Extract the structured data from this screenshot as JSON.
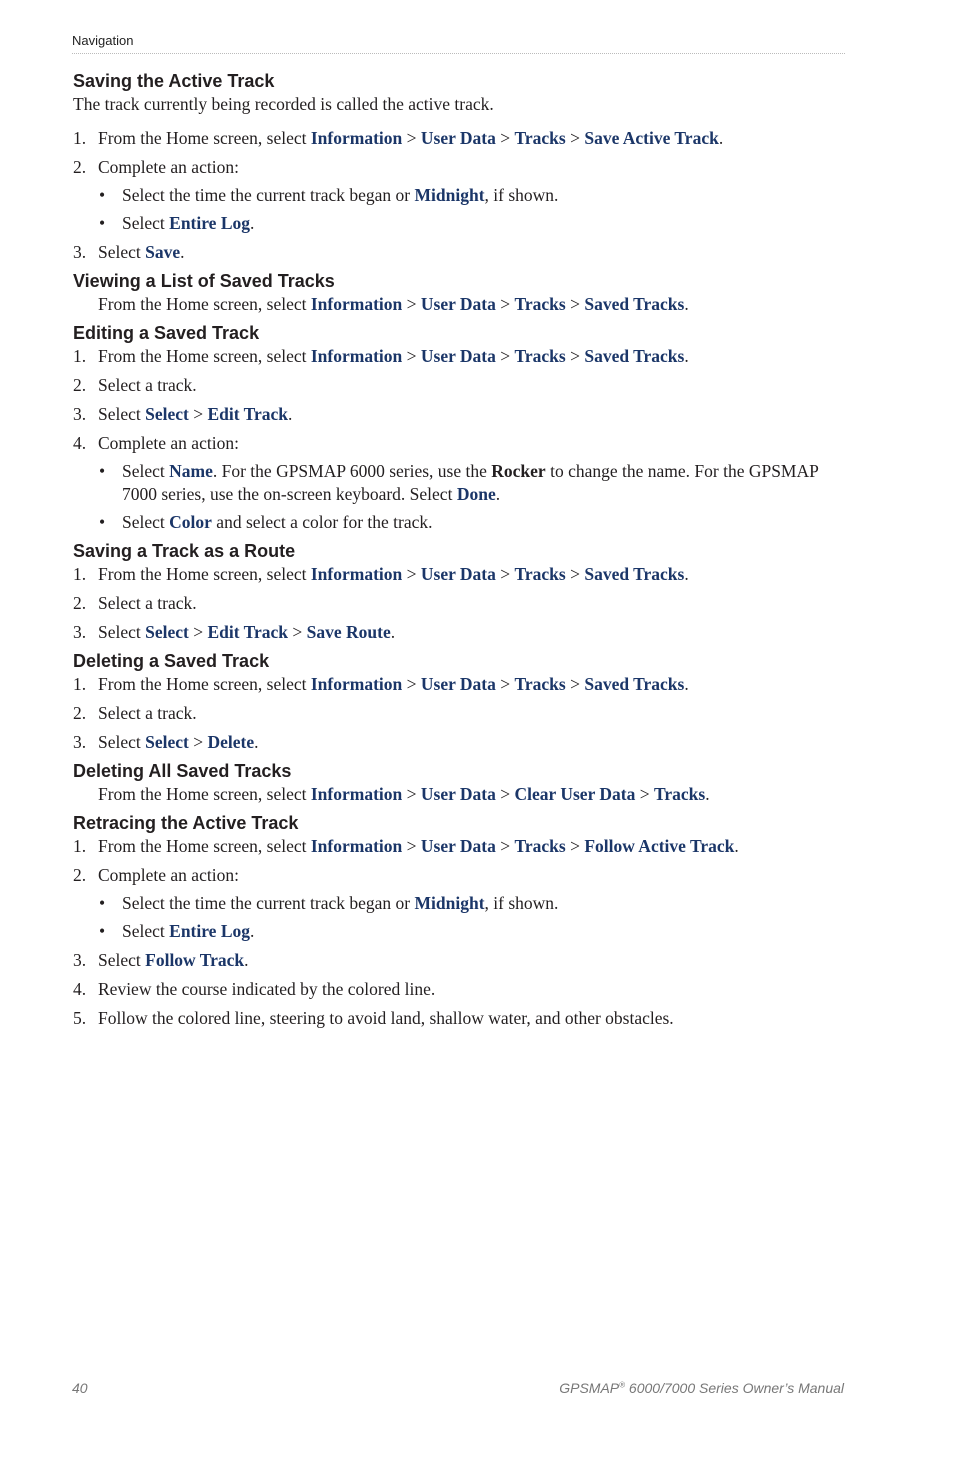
{
  "header": {
    "section": "Navigation"
  },
  "sections": [
    {
      "title": "Saving the Active Track",
      "blocks": [
        {
          "type": "para",
          "segs": [
            {
              "t": "The track currently being recorded is called the active track."
            }
          ]
        },
        {
          "type": "step",
          "num": "1.",
          "segs": [
            {
              "t": "From the Home screen, select "
            },
            {
              "t": "Information",
              "s": "k"
            },
            {
              "t": " > "
            },
            {
              "t": "User Data",
              "s": "k"
            },
            {
              "t": " > "
            },
            {
              "t": "Tracks",
              "s": "k"
            },
            {
              "t": " > "
            },
            {
              "t": "Save Active Track",
              "s": "k"
            },
            {
              "t": "."
            }
          ]
        },
        {
          "type": "step",
          "num": "2.",
          "segs": [
            {
              "t": "Complete an action:"
            }
          ]
        },
        {
          "type": "bullet",
          "segs": [
            {
              "t": "Select the time the current track began or "
            },
            {
              "t": "Midnight",
              "s": "k"
            },
            {
              "t": ", if shown."
            }
          ]
        },
        {
          "type": "bullet",
          "segs": [
            {
              "t": "Select "
            },
            {
              "t": "Entire Log",
              "s": "k"
            },
            {
              "t": "."
            }
          ]
        },
        {
          "type": "step",
          "num": "3.",
          "segs": [
            {
              "t": "Select "
            },
            {
              "t": "Save",
              "s": "k"
            },
            {
              "t": "."
            }
          ]
        }
      ]
    },
    {
      "title": "Viewing a List of Saved Tracks",
      "blocks": [
        {
          "type": "para-indent",
          "segs": [
            {
              "t": "From the Home screen, select "
            },
            {
              "t": "Information",
              "s": "k"
            },
            {
              "t": " > "
            },
            {
              "t": "User Data",
              "s": "k"
            },
            {
              "t": " > "
            },
            {
              "t": "Tracks",
              "s": "k"
            },
            {
              "t": " > "
            },
            {
              "t": "Saved Tracks",
              "s": "k"
            },
            {
              "t": "."
            }
          ]
        }
      ]
    },
    {
      "title": "Editing a Saved Track",
      "blocks": [
        {
          "type": "step",
          "num": "1.",
          "segs": [
            {
              "t": "From the Home screen, select "
            },
            {
              "t": "Information",
              "s": "k"
            },
            {
              "t": " > "
            },
            {
              "t": "User Data",
              "s": "k"
            },
            {
              "t": " > "
            },
            {
              "t": "Tracks",
              "s": "k"
            },
            {
              "t": " > "
            },
            {
              "t": "Saved Tracks",
              "s": "k"
            },
            {
              "t": "."
            }
          ]
        },
        {
          "type": "step",
          "num": "2.",
          "segs": [
            {
              "t": "Select a track."
            }
          ]
        },
        {
          "type": "step",
          "num": "3.",
          "segs": [
            {
              "t": "Select "
            },
            {
              "t": "Select",
              "s": "k"
            },
            {
              "t": " > "
            },
            {
              "t": "Edit Track",
              "s": "k"
            },
            {
              "t": "."
            }
          ]
        },
        {
          "type": "step",
          "num": "4.",
          "segs": [
            {
              "t": "Complete an action:"
            }
          ]
        },
        {
          "type": "bullet",
          "segs": [
            {
              "t": "Select "
            },
            {
              "t": "Name",
              "s": "k"
            },
            {
              "t": ". For the GPSMAP 6000 series, use the "
            },
            {
              "t": "Rocker",
              "s": "b"
            },
            {
              "t": " to change the name. For the GPSMAP 7000 series, use the on-screen keyboard. Select "
            },
            {
              "t": "Done",
              "s": "k"
            },
            {
              "t": "."
            }
          ]
        },
        {
          "type": "bullet",
          "segs": [
            {
              "t": "Select "
            },
            {
              "t": "Color",
              "s": "k"
            },
            {
              "t": " and select a color for the track."
            }
          ]
        }
      ]
    },
    {
      "title": "Saving a Track as a Route",
      "blocks": [
        {
          "type": "step",
          "num": "1.",
          "segs": [
            {
              "t": "From the Home screen, select "
            },
            {
              "t": "Information",
              "s": "k"
            },
            {
              "t": " > "
            },
            {
              "t": "User Data",
              "s": "k"
            },
            {
              "t": " > "
            },
            {
              "t": "Tracks",
              "s": "k"
            },
            {
              "t": " > "
            },
            {
              "t": "Saved Tracks",
              "s": "k"
            },
            {
              "t": "."
            }
          ]
        },
        {
          "type": "step",
          "num": "2.",
          "segs": [
            {
              "t": "Select a track."
            }
          ]
        },
        {
          "type": "step",
          "num": "3.",
          "segs": [
            {
              "t": "Select "
            },
            {
              "t": "Select",
              "s": "k"
            },
            {
              "t": " > "
            },
            {
              "t": "Edit Track",
              "s": "k"
            },
            {
              "t": " > "
            },
            {
              "t": "Save Route",
              "s": "k"
            },
            {
              "t": "."
            }
          ]
        }
      ]
    },
    {
      "title": "Deleting a Saved Track",
      "blocks": [
        {
          "type": "step",
          "num": "1.",
          "segs": [
            {
              "t": "From the Home screen, select "
            },
            {
              "t": "Information",
              "s": "k"
            },
            {
              "t": " > "
            },
            {
              "t": "User Data",
              "s": "k"
            },
            {
              "t": " > "
            },
            {
              "t": "Tracks",
              "s": "k"
            },
            {
              "t": " > "
            },
            {
              "t": "Saved Tracks",
              "s": "k"
            },
            {
              "t": "."
            }
          ]
        },
        {
          "type": "step",
          "num": "2.",
          "segs": [
            {
              "t": "Select a track."
            }
          ]
        },
        {
          "type": "step",
          "num": "3.",
          "segs": [
            {
              "t": "Select "
            },
            {
              "t": "Select",
              "s": "k"
            },
            {
              "t": " > "
            },
            {
              "t": "Delete",
              "s": "k"
            },
            {
              "t": "."
            }
          ]
        }
      ]
    },
    {
      "title": "Deleting All Saved Tracks",
      "blocks": [
        {
          "type": "para-indent",
          "segs": [
            {
              "t": "From the Home screen, select "
            },
            {
              "t": "Information",
              "s": "k"
            },
            {
              "t": " > "
            },
            {
              "t": "User Data",
              "s": "k"
            },
            {
              "t": " > "
            },
            {
              "t": "Clear User Data",
              "s": "k"
            },
            {
              "t": " > "
            },
            {
              "t": "Tracks",
              "s": "k"
            },
            {
              "t": "."
            }
          ]
        }
      ]
    },
    {
      "title": "Retracing the Active Track",
      "blocks": [
        {
          "type": "step",
          "num": "1.",
          "segs": [
            {
              "t": "From the Home screen, select "
            },
            {
              "t": "Information",
              "s": "k"
            },
            {
              "t": " > "
            },
            {
              "t": "User Data",
              "s": "k"
            },
            {
              "t": " > "
            },
            {
              "t": "Tracks",
              "s": "k"
            },
            {
              "t": " > "
            },
            {
              "t": "Follow Active Track",
              "s": "k"
            },
            {
              "t": "."
            }
          ]
        },
        {
          "type": "step",
          "num": "2.",
          "segs": [
            {
              "t": "Complete an action:"
            }
          ]
        },
        {
          "type": "bullet",
          "segs": [
            {
              "t": "Select the time the current track began or "
            },
            {
              "t": "Midnight",
              "s": "k"
            },
            {
              "t": ", if shown."
            }
          ]
        },
        {
          "type": "bullet",
          "segs": [
            {
              "t": "Select "
            },
            {
              "t": "Entire Log",
              "s": "k"
            },
            {
              "t": "."
            }
          ]
        },
        {
          "type": "step",
          "num": "3.",
          "segs": [
            {
              "t": "Select "
            },
            {
              "t": "Follow Track",
              "s": "k"
            },
            {
              "t": "."
            }
          ]
        },
        {
          "type": "step",
          "num": "4.",
          "segs": [
            {
              "t": "Review the course indicated by the colored line."
            }
          ]
        },
        {
          "type": "step",
          "num": "5.",
          "segs": [
            {
              "t": "Follow the colored line, steering to avoid land, shallow water, and other obstacles."
            }
          ]
        }
      ]
    }
  ],
  "footer": {
    "page_number": "40",
    "product": "GPSMAP",
    "registered_mark": "®",
    "manual_title": " 6000/7000 Series Owner’s Manual"
  },
  "colors": {
    "keyword": "#1b3668",
    "text": "#231f20",
    "footer": "#777777"
  }
}
